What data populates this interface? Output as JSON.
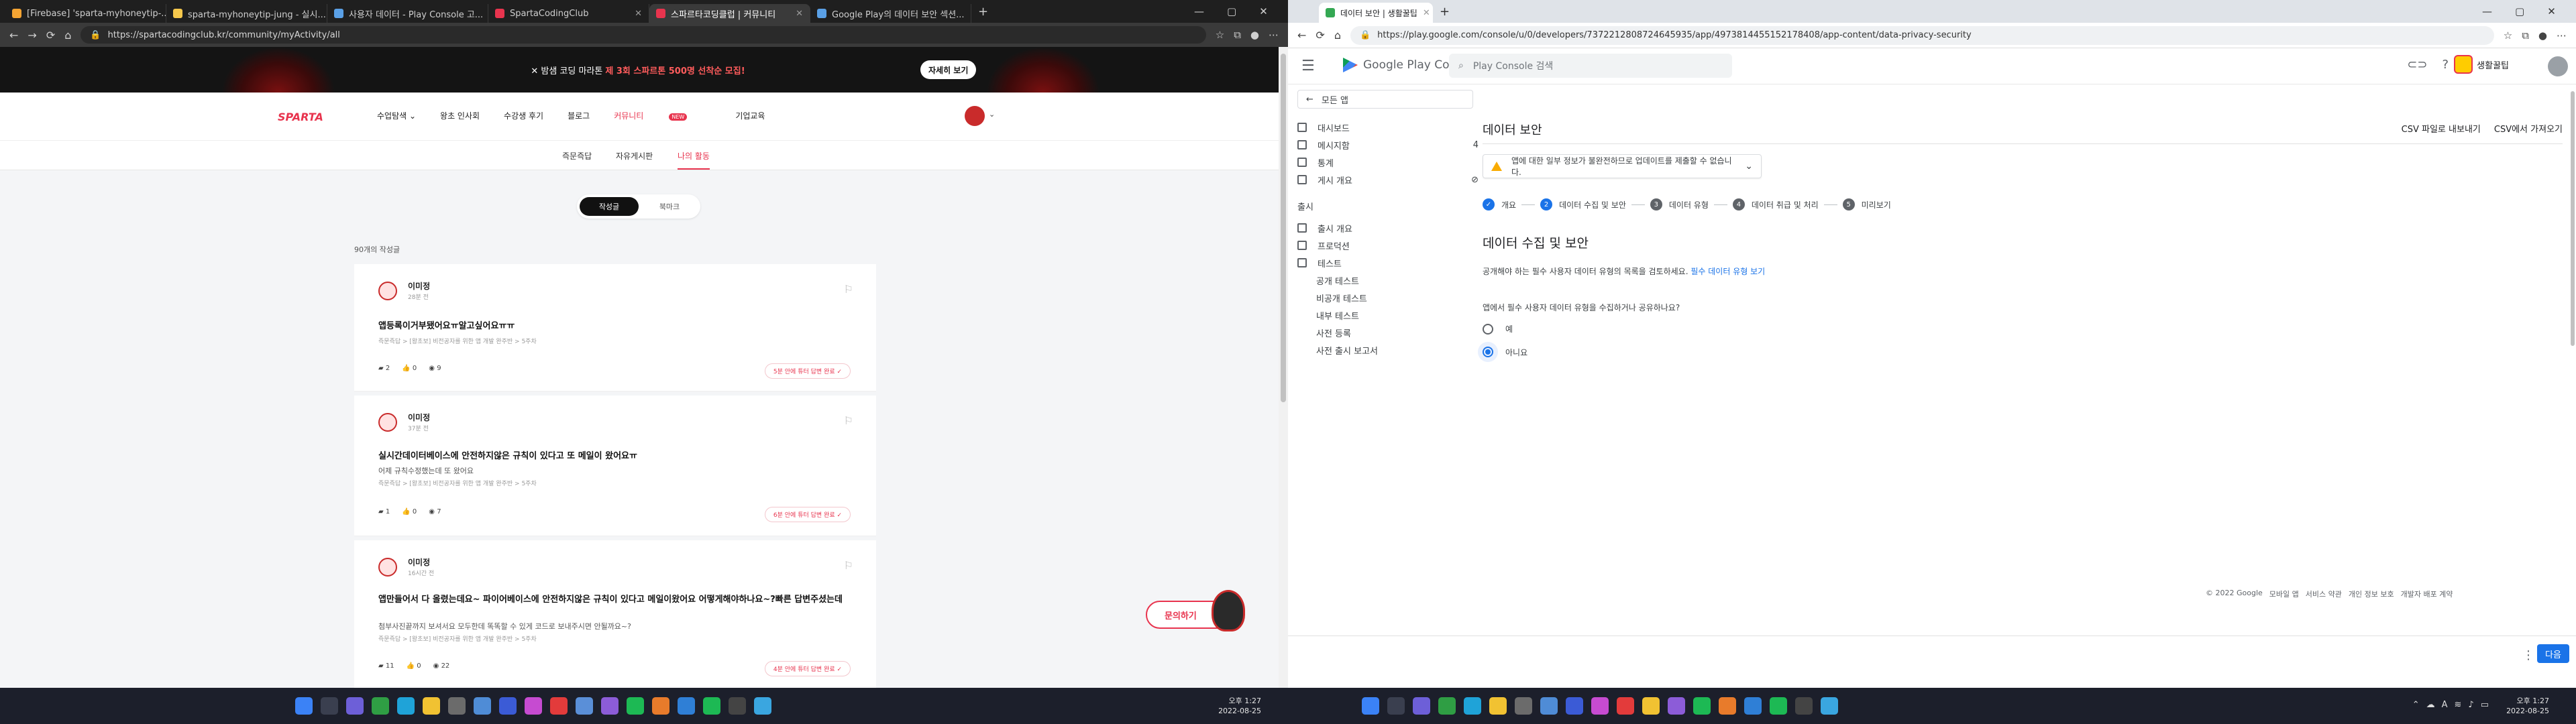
{
  "left": {
    "tabs": [
      {
        "label": "[Firebase] 'sparta-myhoneytip-...",
        "color": "#f4a433"
      },
      {
        "label": "sparta-myhoneytip-jung - 실시...",
        "color": "#f6c84c"
      },
      {
        "label": "사용자 데이터 - Play Console 고...",
        "color": "#5aa0e6"
      },
      {
        "label": "SpartaCodingClub",
        "color": "#e8344e"
      },
      {
        "label": "스파르타코딩클럽 | 커뮤니티",
        "color": "#e8344e"
      },
      {
        "label": "Google Play의 데이터 보안 섹션...",
        "color": "#5aa0e6"
      }
    ],
    "url": "https://spartacodingclub.kr/community/myActivity/all",
    "banner": {
      "prefix": "✕ 밤샘 코딩 마라톤",
      "highlight": "제 3회 스파르톤 500명 선착순 모집!",
      "button": "자세히 보기"
    },
    "logo": "SPARTA",
    "nav": [
      "수업탐색 ⌄",
      "왕초 인사회",
      "수강생 후기",
      "블로그",
      "커뮤니티",
      "기업교육"
    ],
    "nav_new": "NEW",
    "subnav": [
      "즉문즉답",
      "자유게시판",
      "나의 활동"
    ],
    "toggle": {
      "on": "작성글",
      "off": "북마크"
    },
    "count": "90개의 작성글",
    "posts": [
      {
        "name": "이미정",
        "time": "28분 전",
        "title": "앱등록이거부됐어요ㅠ알고싶어요ㅠㅠ",
        "sub": "",
        "meta": "즉문즉답 > [왕초보] 비전공자를 위한 앱 개발 완주반 > 5주차",
        "comments": "2",
        "likes": "0",
        "views": "9",
        "answer": "5분 안에 튜터 답변 완료 ✓"
      },
      {
        "name": "이미정",
        "time": "37분 전",
        "title": "실시간데이터베이스에 안전하지않은 규칙이 있다고 또 메일이 왔어요ㅠ",
        "sub": "어제 규칙수정했는데 또 왔어요",
        "meta": "즉문즉답 > [왕초보] 비전공자를 위한 앱 개발 완주반 > 5주차",
        "comments": "1",
        "likes": "0",
        "views": "7",
        "answer": "6분 안에 튜터 답변 완료 ✓"
      },
      {
        "name": "이미정",
        "time": "16시간 전",
        "title": "앱만들어서 다 올렸는데요~ 파이어베이스에 안전하지않은 규칙이 있다고 메일이왔어요 어떻게해야하나요~?빠른 답변주셨는데",
        "sub": "첨부사진끝까지 보셔서요 모두한데 똑똑할 수 있게 코드로 보내주시면 안될까요~?",
        "meta": "즉문즉답 > [왕초보] 비전공자를 위한 앱 개발 완주반 > 5주차",
        "comments": "11",
        "likes": "0",
        "views": "22",
        "answer": "4분 안에 튜터 답변 완료 ✓"
      }
    ],
    "inquiry": "문의하기",
    "clock": {
      "time": "오후 1:27",
      "date": "2022-08-25"
    }
  },
  "right": {
    "tab_label": "데이터 보안 | 생활꿀팁",
    "url": "https://play.google.com/console/u/0/developers/7372212808724645935/app/4973814455152178408/app-content/data-privacy-security",
    "console_title": "Google Play Console",
    "search_placeholder": "Play Console 검색",
    "account": "생활꿀팁",
    "sidebar": {
      "all_apps": "모든 앱",
      "items": [
        {
          "label": "대시보드"
        },
        {
          "label": "메시지함",
          "count": "4"
        },
        {
          "label": "통계"
        },
        {
          "label": "게시 개요"
        }
      ],
      "release_title": "출시",
      "release_items": [
        "출시 개요",
        "프로덕션",
        "테스트"
      ],
      "test_items": [
        "공개 테스트",
        "비공개 테스트",
        "내부 테스트",
        "사전 등록",
        "사전 출시 보고서"
      ]
    },
    "page_title": "데이터 보안",
    "top_links": [
      "CSV 파일로 내보내기",
      "CSV에서 가져오기"
    ],
    "warning": "앱에 대한 일부 정보가 불완전하므로 업데이트를 제출할 수 없습니다.",
    "steps": [
      {
        "num": "✓",
        "label": "개요"
      },
      {
        "num": "2",
        "label": "데이터 수집 및 보안"
      },
      {
        "num": "3",
        "label": "데이터 유형"
      },
      {
        "num": "4",
        "label": "데이터 취급 및 처리"
      },
      {
        "num": "5",
        "label": "미리보기"
      }
    ],
    "section_title": "데이터 수집 및 보안",
    "description": "공개해야 하는 필수 사용자 데이터 유형의 목록을 검토하세요.",
    "description_link": "필수 데이터 유형 보기",
    "question": "앱에서 필수 사용자 데이터 유형을 수집하거나 공유하나요?",
    "options": [
      "예",
      "아니요"
    ],
    "selected_option": "아니요",
    "footer": [
      "© 2022 Google",
      "모바일 앱",
      "서비스 약관",
      "개인 정보 보호",
      "개발자 배포 계약"
    ],
    "next": "다음",
    "clock": {
      "time": "오후 1:27",
      "date": "2022-08-25"
    }
  }
}
